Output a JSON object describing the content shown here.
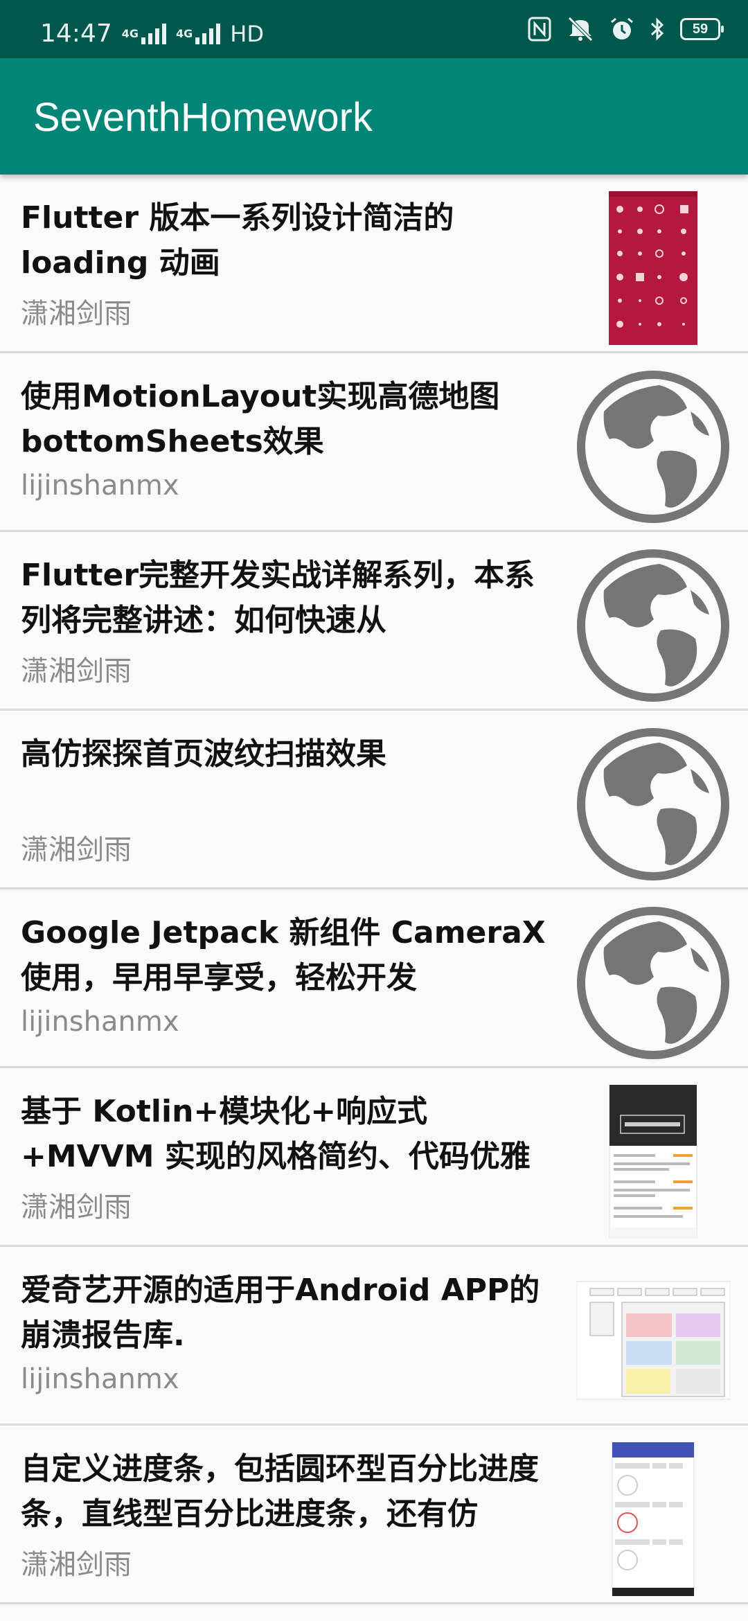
{
  "status_bar": {
    "time": "14:47",
    "network1": "4G",
    "network2": "4G",
    "hd": "HD",
    "battery": "59"
  },
  "app_bar": {
    "title": "SeventhHomework"
  },
  "articles": [
    {
      "title": "Flutter 版本一系列设计简洁的 loading 动画",
      "author": "潇湘剑雨",
      "thumb": "red-loading-screenshot"
    },
    {
      "title": "使用MotionLayout实现高德地图bottomSheets效果",
      "author": "lijinshanmx",
      "thumb": "globe-icon"
    },
    {
      "title": "Flutter完整开发实战详解系列，本系列将完整讲述：如何快速从",
      "author": "潇湘剑雨",
      "thumb": "globe-icon"
    },
    {
      "title": "高仿探探首页波纹扫描效果",
      "author": "潇湘剑雨",
      "thumb": "globe-icon"
    },
    {
      "title": "Google Jetpack 新组件 CameraX 使用，早用早享受，轻松开发 Camera",
      "author": "lijinshanmx",
      "thumb": "globe-icon"
    },
    {
      "title": "基于 Kotlin+模块化+响应式+MVVM 实现的风格简约、代码优雅的",
      "author": "潇湘剑雨",
      "thumb": "dark-app-screenshot"
    },
    {
      "title": "爱奇艺开源的适用于Android APP的崩溃报告库.",
      "author": "lijinshanmx",
      "thumb": "architecture-diagram-screenshot"
    },
    {
      "title": "自定义进度条，包括圆环型百分比进度条，直线型百分比进度条，还有仿",
      "author": "潇湘剑雨",
      "thumb": "progress-demo-screenshot"
    }
  ],
  "colors": {
    "status_bar": "#00574b",
    "app_bar": "#008577",
    "globe": "#757575",
    "loading_red": "#b5183d"
  }
}
